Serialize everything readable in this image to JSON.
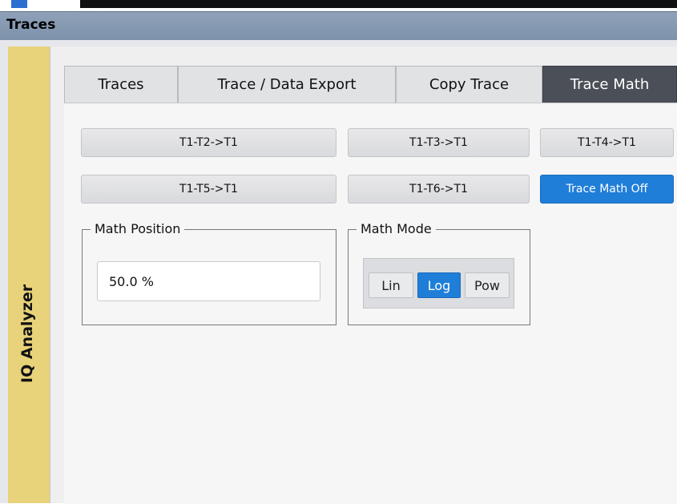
{
  "window": {
    "title": "Traces"
  },
  "sidebar": {
    "label": "IQ Analyzer"
  },
  "tabs": [
    {
      "label": "Traces",
      "active": false
    },
    {
      "label": "Trace / Data Export",
      "active": false
    },
    {
      "label": "Copy Trace",
      "active": false
    },
    {
      "label": "Trace Math",
      "active": true
    }
  ],
  "trace_math": {
    "buttons": [
      {
        "label": "T1-T2->T1",
        "selected": false
      },
      {
        "label": "T1-T3->T1",
        "selected": false
      },
      {
        "label": "T1-T4->T1",
        "selected": false
      },
      {
        "label": "T1-T5->T1",
        "selected": false
      },
      {
        "label": "T1-T6->T1",
        "selected": false
      },
      {
        "label": "Trace Math Off",
        "selected": true
      }
    ],
    "math_position": {
      "legend": "Math Position",
      "value": "50.0 %"
    },
    "math_mode": {
      "legend": "Math Mode",
      "options": [
        {
          "label": "Lin",
          "selected": false
        },
        {
          "label": "Log",
          "selected": true
        },
        {
          "label": "Pow",
          "selected": false
        }
      ]
    }
  },
  "colors": {
    "accent": "#1f7ed8",
    "titlebar": "#7d92ab",
    "sidebar": "#e8d27a",
    "active_tab": "#4a4f58"
  }
}
